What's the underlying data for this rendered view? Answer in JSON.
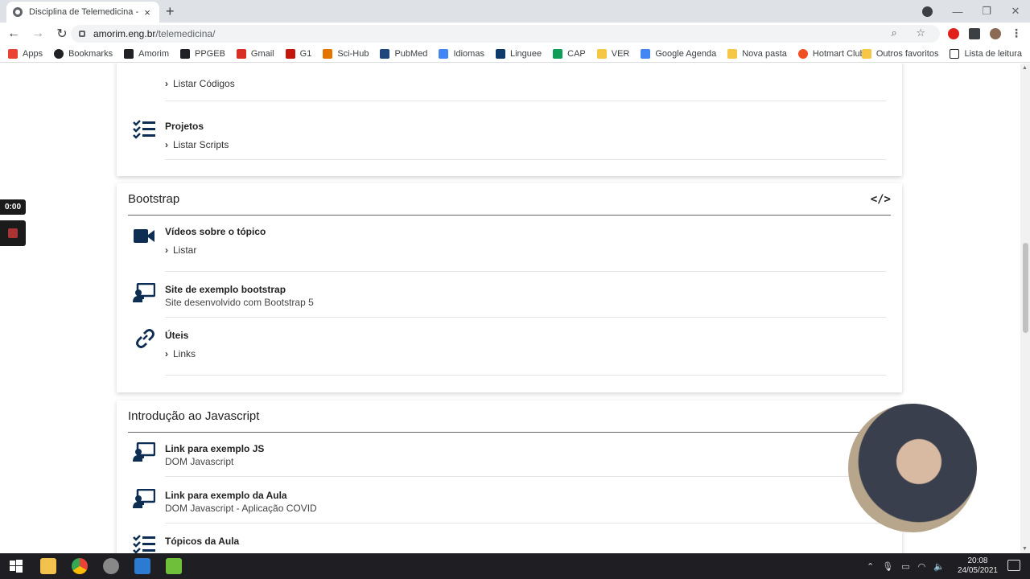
{
  "browser": {
    "tab_title": "Disciplina de Telemedicina - UNI",
    "tab_close": "×",
    "new_tab": "+",
    "url_host": "amorim.eng.br",
    "url_path": "/telemedicina/",
    "window_controls": [
      "—",
      "❐",
      "✕"
    ],
    "omnibox_icons": "⌕ ☆"
  },
  "bookmarks": {
    "items": [
      {
        "label": "Apps",
        "icon": "apps-grid-icon",
        "color": "#ea4335"
      },
      {
        "label": "Bookmarks",
        "icon": "star-icon",
        "color": "#202124"
      },
      {
        "label": "Amorim",
        "icon": "shield-icon",
        "color": "#202124"
      },
      {
        "label": "PPGEB",
        "icon": "bookmark-flag-icon",
        "color": "#202124"
      },
      {
        "label": "Gmail",
        "icon": "gmail-icon",
        "color": "#d93025"
      },
      {
        "label": "G1",
        "icon": "g1-icon",
        "color": "#c4170c"
      },
      {
        "label": "Sci-Hub",
        "icon": "scihub-icon",
        "color": "#e37400"
      },
      {
        "label": "PubMed",
        "icon": "pubmed-icon",
        "color": "#20477b"
      },
      {
        "label": "Idiomas",
        "icon": "translate-icon",
        "color": "#4285f4"
      },
      {
        "label": "Linguee",
        "icon": "linguee-icon",
        "color": "#0f3b6b"
      },
      {
        "label": "CAP",
        "icon": "cap-icon",
        "color": "#0f9d58"
      },
      {
        "label": "VER",
        "icon": "folder-icon",
        "color": "#f6c744"
      },
      {
        "label": "Google Agenda",
        "icon": "calendar-icon",
        "color": "#4285f4"
      },
      {
        "label": "Nova pasta",
        "icon": "folder-icon",
        "color": "#f6c744"
      },
      {
        "label": "Hotmart Club",
        "icon": "flame-icon",
        "color": "#f04e23"
      }
    ],
    "right": [
      {
        "label": "Outros favoritos",
        "icon": "folder-icon",
        "color": "#f6c744"
      },
      {
        "label": "Lista de leitura",
        "icon": "reading-list-icon",
        "color": "#202124"
      }
    ]
  },
  "page": {
    "accent_color": "#0d2d52",
    "top_card": {
      "link_codes": "Listar Códigos",
      "projects_title": "Projetos",
      "projects_link": "Listar Scripts"
    },
    "bootstrap_card": {
      "title": "Bootstrap",
      "code_icon": "</>",
      "videos_title": "Vídeos sobre o tópico",
      "videos_link": "Listar",
      "example_title": "Site de exemplo bootstrap",
      "example_sub": "Site desenvolvido com Bootstrap 5",
      "useful_title": "Úteis",
      "useful_link": "Links"
    },
    "js_card": {
      "title": "Introdução ao Javascript",
      "item1_title": "Link para exemplo JS",
      "item1_sub": "DOM Javascript",
      "item2_title": "Link para exemplo da Aula",
      "item2_sub": "DOM Javascript - Aplicação COVID",
      "item3_title": "Tópicos da Aula"
    }
  },
  "recorder": {
    "time": "0:00"
  },
  "taskbar": {
    "time": "20:08",
    "date": "24/05/2021"
  }
}
